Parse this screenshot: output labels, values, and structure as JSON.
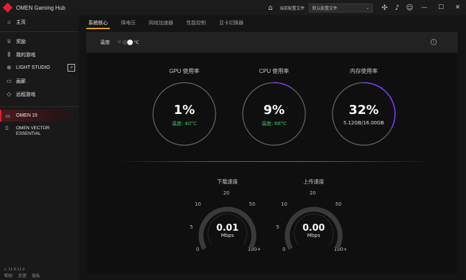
{
  "app": {
    "title": "OMEN Gaming Hub"
  },
  "titlebar": {
    "profile_label": "当前配置文件",
    "profile_value": "默认配置文件",
    "icons": [
      "home-icon",
      "gamepad-icon",
      "bell-icon",
      "user-icon"
    ],
    "window": [
      "minimize",
      "maximize",
      "close"
    ]
  },
  "sidebar": {
    "items": [
      {
        "icon": "home-icon",
        "label": "主页"
      },
      {
        "icon": "trophy-icon",
        "label": "奖励"
      },
      {
        "icon": "library-icon",
        "label": "我的游戏"
      },
      {
        "icon": "light-studio-icon",
        "label": "LIGHT STUDIO"
      },
      {
        "icon": "gallery-icon",
        "label": "画廊"
      },
      {
        "icon": "remote-play-icon",
        "label": "远程游戏"
      }
    ],
    "devices": [
      {
        "icon": "laptop-icon",
        "label": "OMEN 15",
        "active": true
      },
      {
        "icon": "desktop-icon",
        "label_line1": "OMEN VECTOR",
        "label_line2": "ESSENTIAL",
        "active": false
      }
    ],
    "footer": {
      "version": "v. 11.8.11.0",
      "links": [
        "帮助",
        "反馈",
        "隐私"
      ]
    }
  },
  "tabs": [
    {
      "label": "系统核心",
      "active": true
    },
    {
      "label": "降电压",
      "active": false
    },
    {
      "label": "网络加速器",
      "active": false
    },
    {
      "label": "性能控制",
      "active": false
    },
    {
      "label": "显卡切换器",
      "active": false
    }
  ],
  "temperature": {
    "label": "温度",
    "unit_f": "°F",
    "unit_c": "°C",
    "selected": "°C"
  },
  "metrics": {
    "gpu": {
      "label": "GPU 使用率",
      "value": "1%",
      "sub_label": "温度:",
      "sub_value": "40°C",
      "percent": 1
    },
    "cpu": {
      "label": "CPU 使用率",
      "value": "9%",
      "sub_label": "温度:",
      "sub_value": "66°C",
      "percent": 9
    },
    "memory": {
      "label": "内存使用率",
      "value": "32%",
      "sub": "5.12GB/16.00GB",
      "percent": 32
    }
  },
  "network": {
    "download": {
      "label": "下载速度",
      "value": "0.01",
      "unit": "Mbps",
      "ticks": [
        "0",
        "5",
        "10",
        "20",
        "50",
        "100+"
      ]
    },
    "upload": {
      "label": "上传速度",
      "value": "0.00",
      "unit": "Mbps",
      "ticks": [
        "0",
        "5",
        "10",
        "20",
        "50",
        "100+"
      ]
    }
  },
  "colors": {
    "accent_red": "#e5202e",
    "tab_underline": "#e5a020",
    "temp_green": "#2fd05f",
    "ring_accent": "#7a3cff"
  }
}
